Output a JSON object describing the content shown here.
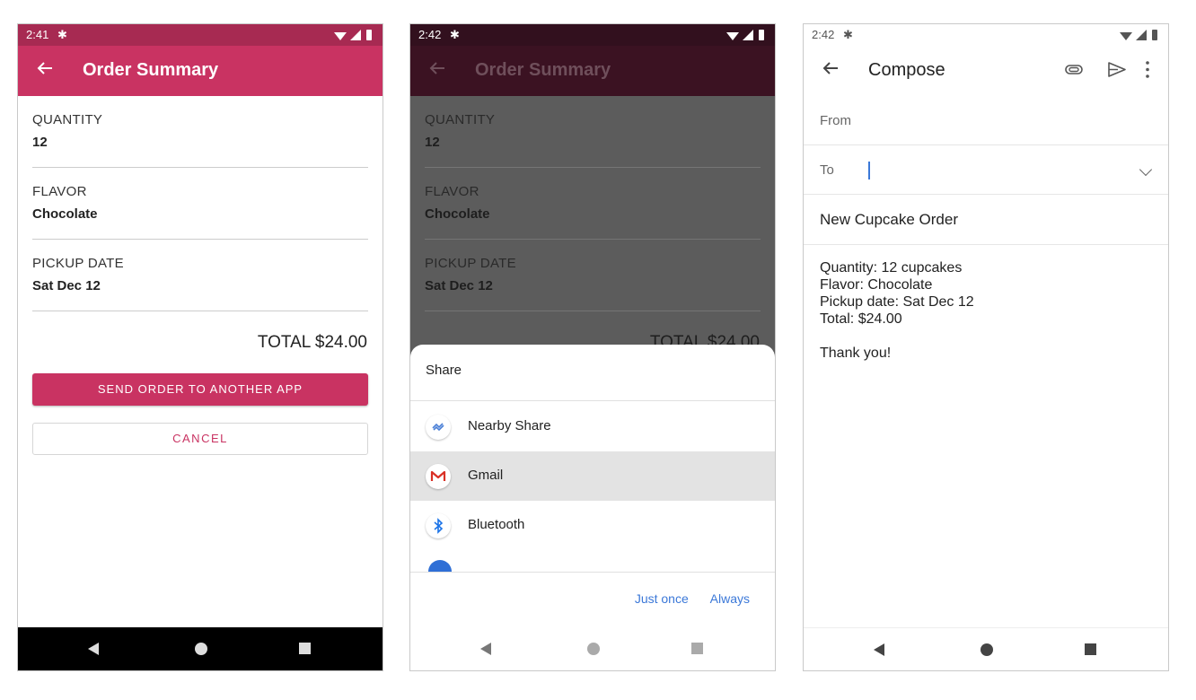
{
  "phone1": {
    "status": {
      "time": "2:41"
    },
    "appbar": {
      "title": "Order Summary"
    },
    "rows": [
      {
        "label": "QUANTITY",
        "value": "12"
      },
      {
        "label": "FLAVOR",
        "value": "Chocolate"
      },
      {
        "label": "PICKUP DATE",
        "value": "Sat Dec 12"
      }
    ],
    "total": "TOTAL $24.00",
    "send_button": "SEND ORDER TO ANOTHER APP",
    "cancel_button": "CANCEL"
  },
  "phone2": {
    "status": {
      "time": "2:42"
    },
    "appbar": {
      "title": "Order Summary"
    },
    "rows": [
      {
        "label": "QUANTITY",
        "value": "12"
      },
      {
        "label": "FLAVOR",
        "value": "Chocolate"
      },
      {
        "label": "PICKUP DATE",
        "value": "Sat Dec 12"
      }
    ],
    "total": "TOTAL $24.00",
    "sheet": {
      "title": "Share",
      "items": [
        {
          "name": "Nearby Share",
          "icon": "nearby-share-icon"
        },
        {
          "name": "Gmail",
          "icon": "gmail-icon",
          "selected": true
        },
        {
          "name": "Bluetooth",
          "icon": "bluetooth-icon"
        }
      ],
      "just_once": "Just once",
      "always": "Always"
    }
  },
  "phone3": {
    "status": {
      "time": "2:42"
    },
    "appbar": {
      "title": "Compose"
    },
    "from_label": "From",
    "to_label": "To",
    "subject": "New Cupcake Order",
    "body": "Quantity: 12 cupcakes\nFlavor: Chocolate\nPickup date: Sat Dec 12\nTotal: $24.00\n\nThank you!"
  },
  "colors": {
    "accent": "#c93362",
    "status_dark": "#a72a52",
    "link_blue": "#3b78d8"
  }
}
